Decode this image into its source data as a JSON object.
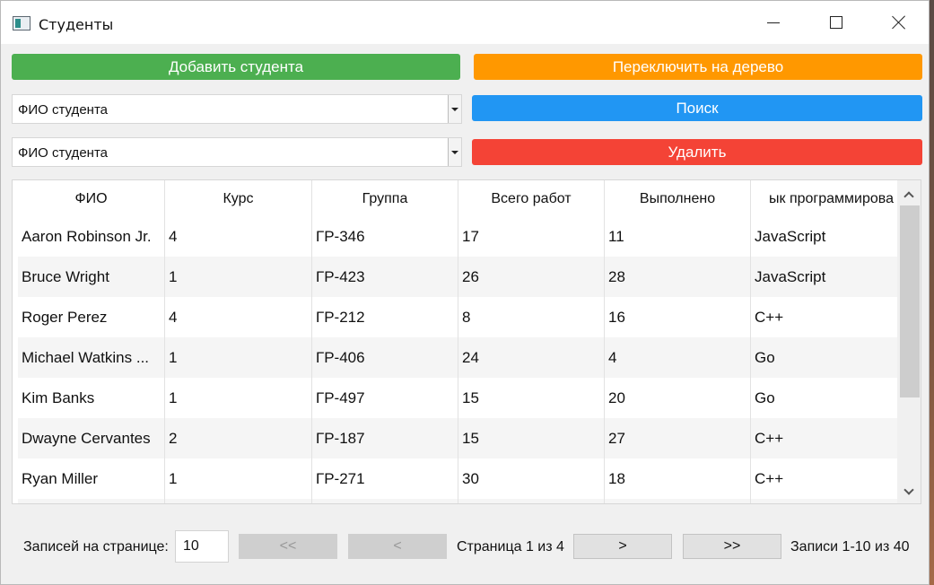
{
  "window": {
    "title": "Студенты",
    "app_icon": "window-app-icon"
  },
  "toolbar": {
    "add_label": "Добавить студента",
    "tree_label": "Переключить на дерево",
    "search_label": "Поиск",
    "delete_label": "Удалить",
    "colors": {
      "add": "#4caf50",
      "tree": "#ff9800",
      "search": "#2196f3",
      "delete": "#f44336"
    }
  },
  "search_combo": {
    "selected": "ФИО студента"
  },
  "delete_combo": {
    "selected": "ФИО студента"
  },
  "table": {
    "headers": [
      "ФИО",
      "Курс",
      "Группа",
      "Всего работ",
      "Выполнено",
      "ык программирова"
    ],
    "rows": [
      [
        "Aaron Robinson Jr.",
        "4",
        "ГР-346",
        "17",
        "11",
        "JavaScript"
      ],
      [
        "Bruce Wright",
        "1",
        "ГР-423",
        "26",
        "28",
        "JavaScript"
      ],
      [
        "Roger Perez",
        "4",
        "ГР-212",
        "8",
        "16",
        "C++"
      ],
      [
        "Michael Watkins ...",
        "1",
        "ГР-406",
        "24",
        "4",
        "Go"
      ],
      [
        "Kim Banks",
        "1",
        "ГР-497",
        "15",
        "20",
        "Go"
      ],
      [
        "Dwayne Cervantes",
        "2",
        "ГР-187",
        "15",
        "27",
        "C++"
      ],
      [
        "Ryan Miller",
        "1",
        "ГР-271",
        "30",
        "18",
        "C++"
      ],
      [
        "",
        "",
        "",
        "",
        "",
        ""
      ]
    ]
  },
  "pager": {
    "per_page_label": "Записей на странице:",
    "per_page_value": "10",
    "first_label": "<<",
    "prev_label": "<",
    "page_label": "Страница 1 из 4",
    "next_label": ">",
    "last_label": ">>",
    "records_label": "Записи 1-10 из 40"
  }
}
